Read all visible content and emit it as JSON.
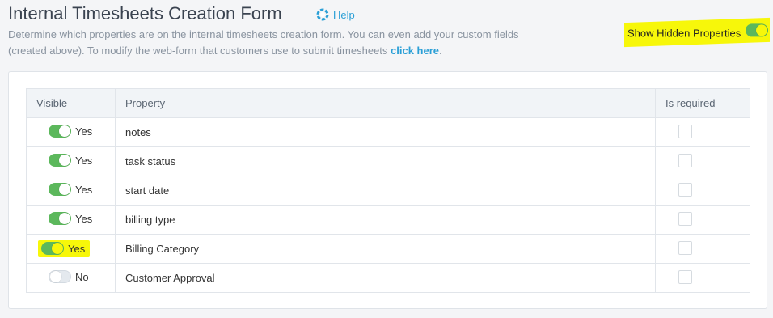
{
  "header": {
    "title": "Internal Timesheets Creation Form",
    "help_label": "Help",
    "description_text": "Determine which properties are on the internal timesheets creation form. You can even add your custom fields (created above). To modify the web-form that customers use to submit timesheets ",
    "description_link": "click here",
    "description_end": "."
  },
  "hidden_properties": {
    "label": "Show Hidden Properties",
    "enabled": true
  },
  "table": {
    "headers": {
      "visible": "Visible",
      "property": "Property",
      "required": "Is required"
    },
    "rows": [
      {
        "visible_label": "Yes",
        "property": "notes"
      },
      {
        "visible_label": "Yes",
        "property": "task status"
      },
      {
        "visible_label": "Yes",
        "property": "start date"
      },
      {
        "visible_label": "Yes",
        "property": "billing type"
      },
      {
        "visible_label": "Yes",
        "property": "Billing Category"
      },
      {
        "visible_label": "No",
        "property": "Customer Approval"
      }
    ]
  },
  "colors": {
    "accent": "#2a9fd6",
    "toggle_on": "#5cb85c",
    "highlight": "#f7f70a"
  },
  "icons": {
    "help": "lifebuoy-icon"
  }
}
